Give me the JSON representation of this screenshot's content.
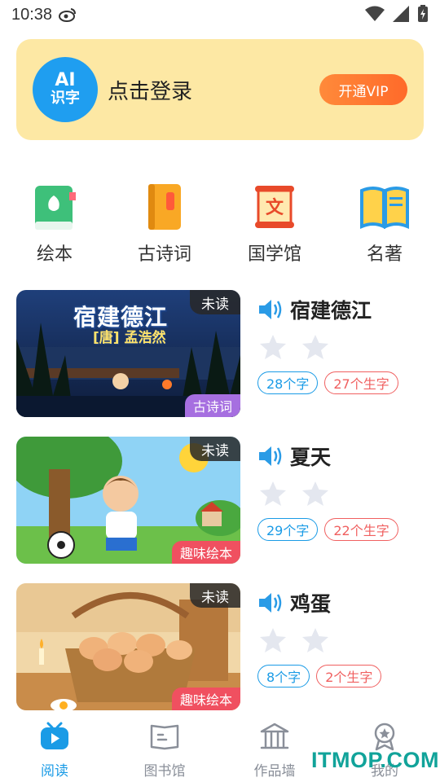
{
  "status_bar": {
    "time": "10:38"
  },
  "login_card": {
    "avatar_line1": "AI",
    "avatar_line2": "识字",
    "prompt": "点击登录",
    "vip_label": "开通VIP"
  },
  "categories": [
    {
      "label": "绘本",
      "icon": "picture-book-icon"
    },
    {
      "label": "古诗词",
      "icon": "poetry-book-icon"
    },
    {
      "label": "国学馆",
      "icon": "scroll-icon"
    },
    {
      "label": "名著",
      "icon": "open-book-icon"
    }
  ],
  "books": [
    {
      "title": "宿建德江",
      "status": "未读",
      "category": "古诗词",
      "chars": "28个字",
      "new_chars": "27个生字",
      "stars": 2,
      "cover_title": "宿建德江",
      "cover_author": "[唐] 孟浩然",
      "category_color": "#a66fe0"
    },
    {
      "title": "夏天",
      "status": "未读",
      "category": "趣味绘本",
      "chars": "29个字",
      "new_chars": "22个生字",
      "stars": 2,
      "category_color": "#f05060"
    },
    {
      "title": "鸡蛋",
      "status": "未读",
      "category": "趣味绘本",
      "chars": "8个字",
      "new_chars": "2个生字",
      "stars": 2,
      "category_color": "#f05060"
    }
  ],
  "tab_bar": {
    "tabs": [
      {
        "label": "阅读",
        "icon": "tv-play-icon",
        "active": true
      },
      {
        "label": "图书馆",
        "icon": "book-icon",
        "active": false
      },
      {
        "label": "作品墙",
        "icon": "museum-icon",
        "active": false
      },
      {
        "label": "我的",
        "icon": "medal-icon",
        "active": false
      }
    ]
  },
  "watermark": "ITMOP.COM",
  "colors": {
    "accent": "#1a9be6",
    "vip": "#ff7a30",
    "card_bg": "#fde8a4"
  }
}
